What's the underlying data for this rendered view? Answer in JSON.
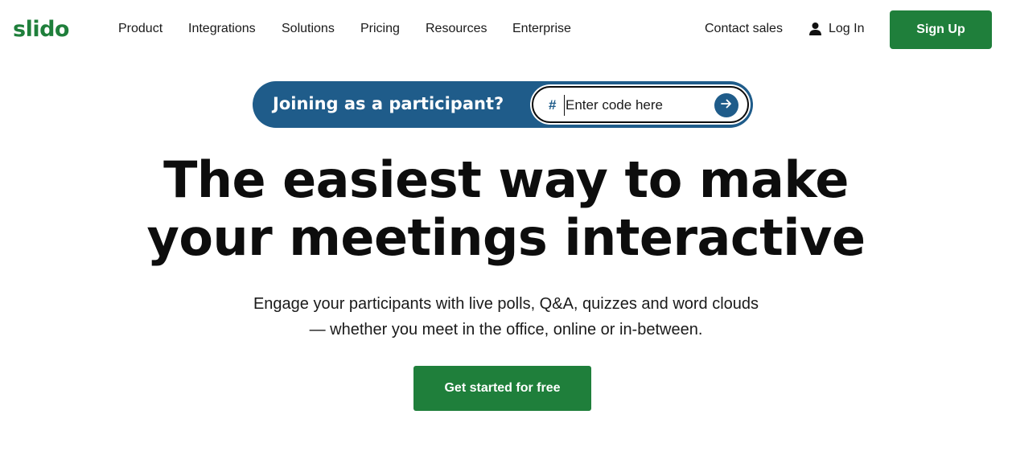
{
  "brand": {
    "logo_text": "slido",
    "color": "#1f7f3b"
  },
  "nav": {
    "items": [
      {
        "label": "Product"
      },
      {
        "label": "Integrations"
      },
      {
        "label": "Solutions"
      },
      {
        "label": "Pricing"
      },
      {
        "label": "Resources"
      },
      {
        "label": "Enterprise"
      }
    ],
    "contact_label": "Contact sales",
    "login_label": "Log In",
    "login_icon": "user-icon",
    "signup_label": "Sign Up"
  },
  "join": {
    "label": "Joining as a participant?",
    "hash_symbol": "#",
    "placeholder": "Enter code here",
    "value": "",
    "submit_icon": "arrow-right-icon",
    "bar_color": "#1f5c8a"
  },
  "hero": {
    "title_line1": "The easiest way to make",
    "title_line2": "your meetings interactive",
    "subtitle_line1": "Engage your participants with live polls, Q&A, quizzes and word clouds",
    "subtitle_line2": "— whether you meet in the office, online or in-between.",
    "cta_label": "Get started for free",
    "cta_color": "#1f7f3b"
  }
}
